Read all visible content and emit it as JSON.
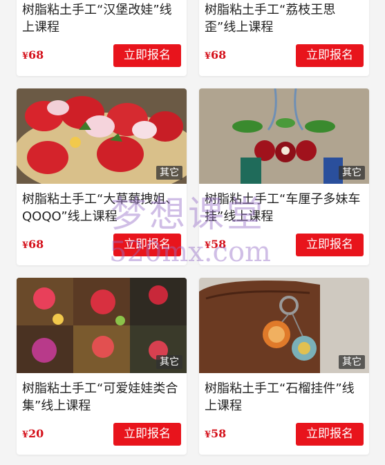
{
  "courses": [
    {
      "title": "树脂粘土手工“汉堡改娃”线上课程",
      "currency": "¥",
      "price": "68",
      "button": "立即报名"
    },
    {
      "title": "树脂粘土手工“荔枝王思歪”线上课程",
      "currency": "¥",
      "price": "68",
      "button": "立即报名"
    },
    {
      "title": "树脂粘土手工“大草莓拽姐、QOQO”线上课程",
      "tag": "其它",
      "currency": "¥",
      "price": "68",
      "button": "立即报名"
    },
    {
      "title": "树脂粘土手工“车厘子多妹车挂”线上课程",
      "tag": "其它",
      "currency": "¥",
      "price": "58",
      "button": "立即报名"
    },
    {
      "title": "树脂粘土手工“可爱娃娃类合集”线上课程",
      "tag": "其它",
      "currency": "¥",
      "price": "20",
      "button": "立即报名"
    },
    {
      "title": "树脂粘土手工“石榴挂件”线上课程",
      "tag": "其它",
      "currency": "¥",
      "price": "58",
      "button": "立即报名"
    }
  ],
  "watermark": {
    "brand": "梦想课堂",
    "domain": "520mx.com"
  },
  "colors": {
    "accent": "#e8141c",
    "price": "#d4101a"
  }
}
